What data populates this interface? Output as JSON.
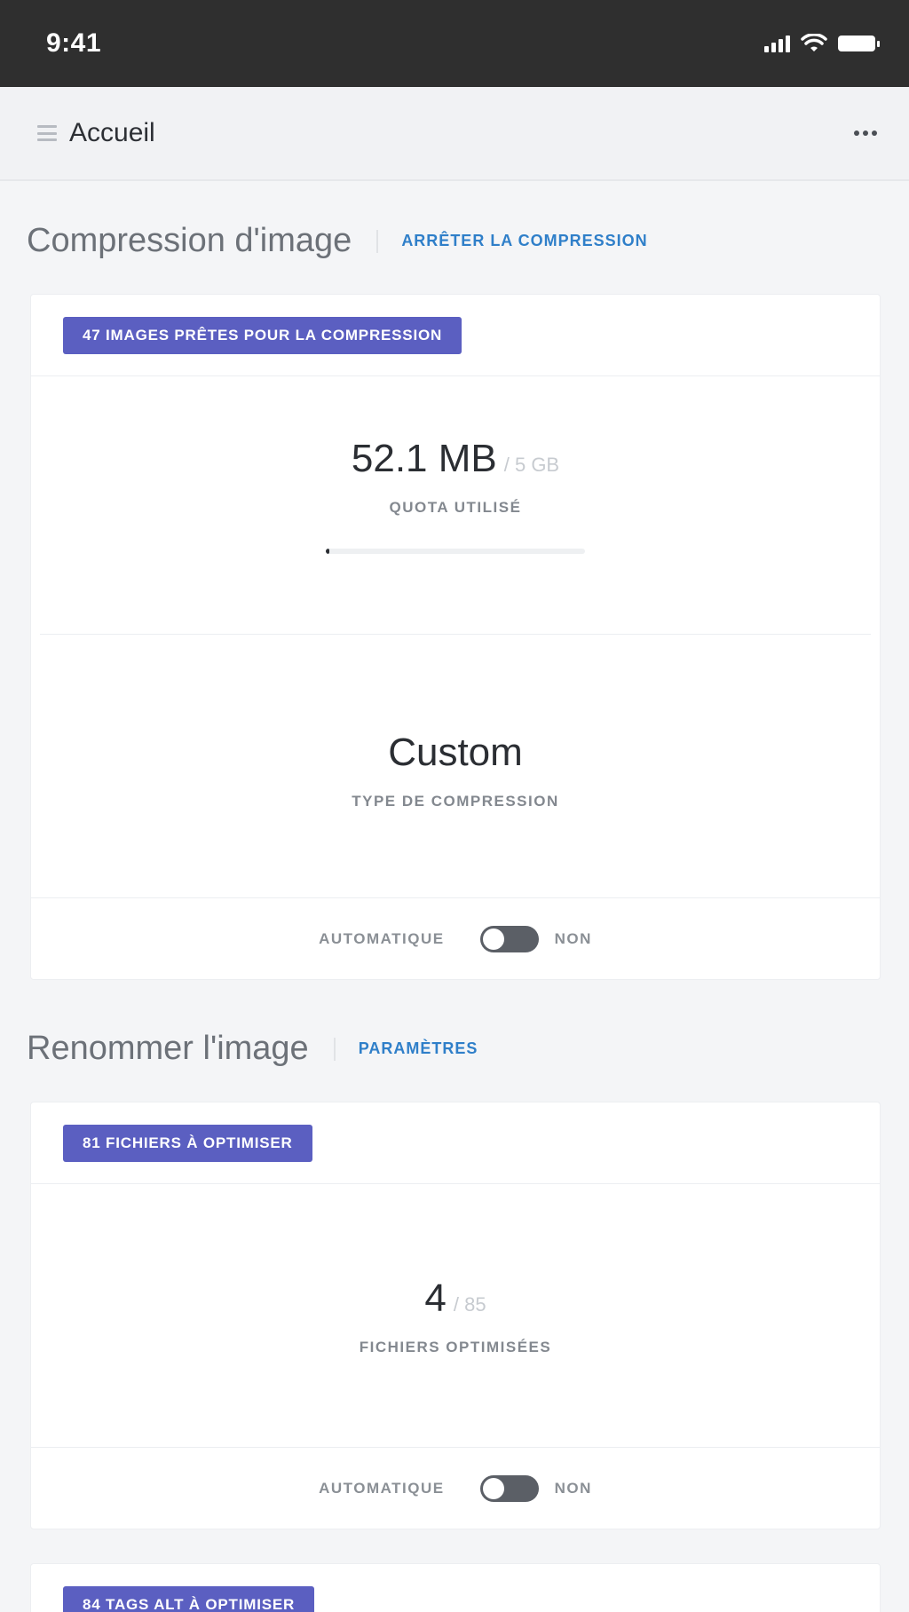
{
  "status_bar": {
    "time": "9:41",
    "icons": [
      "signal-icon",
      "wifi-icon",
      "battery-icon"
    ]
  },
  "nav": {
    "title": "Accueil",
    "menu_icon": "menu-icon",
    "more_icon": "more-icon"
  },
  "sections": {
    "compression": {
      "title": "Compression d'image",
      "action": "ARRÊTER LA COMPRESSION",
      "badge": "47 IMAGES PRÊTES POUR LA COMPRESSION",
      "quota": {
        "value": "52.1 MB",
        "total": "/ 5 GB",
        "label": "QUOTA UTILISÉ",
        "progress_fraction": 0.01
      },
      "type": {
        "value": "Custom",
        "label": "TYPE DE COMPRESSION"
      },
      "auto": {
        "label": "AUTOMATIQUE",
        "state": "NON",
        "on": false
      }
    },
    "rename": {
      "title": "Renommer l'image",
      "action": "PARAMÈTRES",
      "badge": "81 FICHIERS À OPTIMISER",
      "files": {
        "value": "4",
        "total": "/ 85",
        "label": "FICHIERS OPTIMISÉES"
      },
      "auto": {
        "label": "AUTOMATIQUE",
        "state": "NON",
        "on": false
      }
    },
    "alt": {
      "badge": "84 TAGS ALT À OPTIMISER"
    }
  },
  "colors": {
    "badge": "#5b5fc1",
    "link": "#2f7fc9",
    "status_bar": "#2f2f2f"
  }
}
